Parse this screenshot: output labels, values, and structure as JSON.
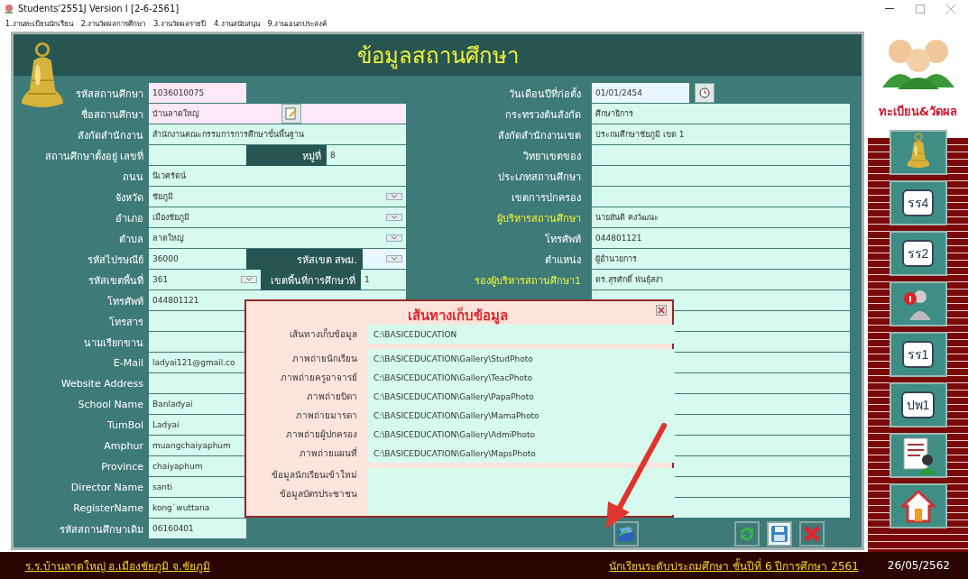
{
  "window": {
    "title": "Students'2551J Version I [2-6-2561]"
  },
  "menu": [
    "1.งานทะเบียนนักเรียน",
    "2.งานวัดผลการศึกษา",
    "3.งานวัดผลรายปี",
    "4.งานสนับสนุน",
    "9.งานเอนกประสงค์"
  ],
  "form": {
    "title": "ข้อมูลสถานศึกษา",
    "left_rows": [
      {
        "kind": "short",
        "label": "รหัสสถานศึกษา",
        "value": "1036010075",
        "color": "#fde8f7"
      },
      {
        "kind": "edit",
        "label": "ชื่อสถานศึกษา",
        "value": "บ้านลาดใหญ่",
        "color": "#fde8f7"
      },
      {
        "kind": "text",
        "label": "สังกัดสำนักงาน",
        "value": "สำนักงานคณะกรรมการการศึกษาขั้นพื้นฐาน"
      },
      {
        "kind": "split",
        "label": "สถานศึกษาตั้งอยู่ เลขที่",
        "value": "",
        "sublabel": "หมู่ที่",
        "subvalue": "8"
      },
      {
        "kind": "text",
        "label": "ถนน",
        "value": "นิเวศรัตน์"
      },
      {
        "kind": "select",
        "label": "จังหวัด",
        "value": "ชัยภูมิ"
      },
      {
        "kind": "select",
        "label": "อำเภอ",
        "value": "เมืองชัยภูมิ"
      },
      {
        "kind": "select",
        "label": "ตำบล",
        "value": "ลาดใหญ่"
      },
      {
        "kind": "splitselect",
        "label": "รหัสไปรษณีย์",
        "value": "36000",
        "sublabel": "รหัสเขต สพม.",
        "subvalue": ""
      },
      {
        "kind": "selectsplit",
        "label": "รหัสเขตพื้นที่",
        "value": "361",
        "sublabel": "เขตพื้นที่การศึกษาที่",
        "subvalue": "1"
      },
      {
        "kind": "text",
        "label": "โทรศัพท์",
        "value": "044801121"
      },
      {
        "kind": "text",
        "label": "โทรสาร",
        "value": ""
      },
      {
        "kind": "text",
        "label": "นามเรียกขาน",
        "value": ""
      },
      {
        "kind": "text",
        "label": "E-Mail",
        "value": "ladyai121@gmail.co"
      },
      {
        "kind": "text",
        "label": "Website Address",
        "value": ""
      },
      {
        "kind": "text",
        "label": "School Name",
        "value": "Banladyai"
      },
      {
        "kind": "text",
        "label": "TumBol",
        "value": "Ladyai"
      },
      {
        "kind": "text",
        "label": "Amphur",
        "value": "muangchaiyaphum"
      },
      {
        "kind": "text",
        "label": "Province",
        "value": "chaiyaphum"
      },
      {
        "kind": "text",
        "label": "Director Name",
        "value": "santi"
      },
      {
        "kind": "text",
        "label": "RegisterName",
        "value": "kong`wuttana"
      },
      {
        "kind": "short",
        "label": "รหัสสถานศึกษาเดิม",
        "value": "06160401",
        "color": "#d6fbee"
      }
    ],
    "right_rows": [
      {
        "kind": "date",
        "label": "วันเดือนปีที่ก่อตั้ง",
        "value": "01/01/2454",
        "highlight": false
      },
      {
        "kind": "text",
        "label": "กระทรวงต้นสังกัด",
        "value": "ศึกษาธิการ",
        "highlight": false
      },
      {
        "kind": "text",
        "label": "สังกัดสำนักงานเขต",
        "value": "ประถมศึกษาชัยภูมิ เขต 1",
        "highlight": false
      },
      {
        "kind": "text",
        "label": "วิทยาเขตของ",
        "value": "",
        "highlight": false
      },
      {
        "kind": "text",
        "label": "ประเภทสถานศึกษา",
        "value": "",
        "highlight": false
      },
      {
        "kind": "text",
        "label": "เขตการปกครอง",
        "value": "",
        "highlight": false
      },
      {
        "kind": "text",
        "label": "ผู้บริหารสถานศึกษา",
        "value": "นายสันติ คงวัฒนะ",
        "highlight": true
      },
      {
        "kind": "text",
        "label": "โทรศัพท์",
        "value": "044801121",
        "highlight": false
      },
      {
        "kind": "text",
        "label": "ตำแหน่ง",
        "value": "ผู้อำนวยการ",
        "highlight": false
      },
      {
        "kind": "text",
        "label": "รองผู้บริหารสถานศึกษา1",
        "value": "ดร.สุรศักดิ์ พันธุ์สง่า",
        "highlight": true
      }
    ]
  },
  "dialog": {
    "title": "เส้นทางเก็บข้อมูล",
    "rows": [
      {
        "label": "เส้นทางเก็บข้อมูล",
        "value": "C:\\BASICEDUCATION"
      },
      {
        "label": "ภาพถ่ายนักเรียน",
        "value": "C:\\BASICEDUCATION\\Gallery\\StudPhoto"
      },
      {
        "label": "ภาพถ่ายครูอาจารย์",
        "value": "C:\\BASICEDUCATION\\Gallery\\TeacPhoto"
      },
      {
        "label": "ภาพถ่ายบิดา",
        "value": "C:\\BASICEDUCATION\\Gallery\\PapaPhoto"
      },
      {
        "label": "ภาพถ่ายมารดา",
        "value": "C:\\BASICEDUCATION\\Gallery\\MamaPhoto"
      },
      {
        "label": "ภาพถ่ายผู้ปกครอง",
        "value": "C:\\BASICEDUCATION\\Gallery\\AdmiPhoto"
      },
      {
        "label": "ภาพถ่ายแผนที่",
        "value": "C:\\BASICEDUCATION\\Gallery\\MapsPhoto"
      }
    ],
    "note_labels": [
      "ข้อมูลนักเรียนเข้าใหม่",
      "ข้อมูลบัตรประชาชน"
    ]
  },
  "sidebar": {
    "heading": "ทะเบียน&วัดผล",
    "buttons": [
      {
        "kind": "bell"
      },
      {
        "kind": "text",
        "label": "รร4"
      },
      {
        "kind": "text",
        "label": "รร2"
      },
      {
        "kind": "info"
      },
      {
        "kind": "text",
        "label": "รร1"
      },
      {
        "kind": "text",
        "label": "ปพ1"
      },
      {
        "kind": "report"
      },
      {
        "kind": "home"
      }
    ]
  },
  "status_bar": {
    "school": "ร.ร.บ้านลาดใหญ่  อ.เมืองชัยภูมิ  จ.ชัยภูมิ",
    "level": "นักเรียนระดับประถมศึกษา  ชั้นปีที่ 6  ปีการศึกษา 2561",
    "date": "26/05/2562"
  }
}
